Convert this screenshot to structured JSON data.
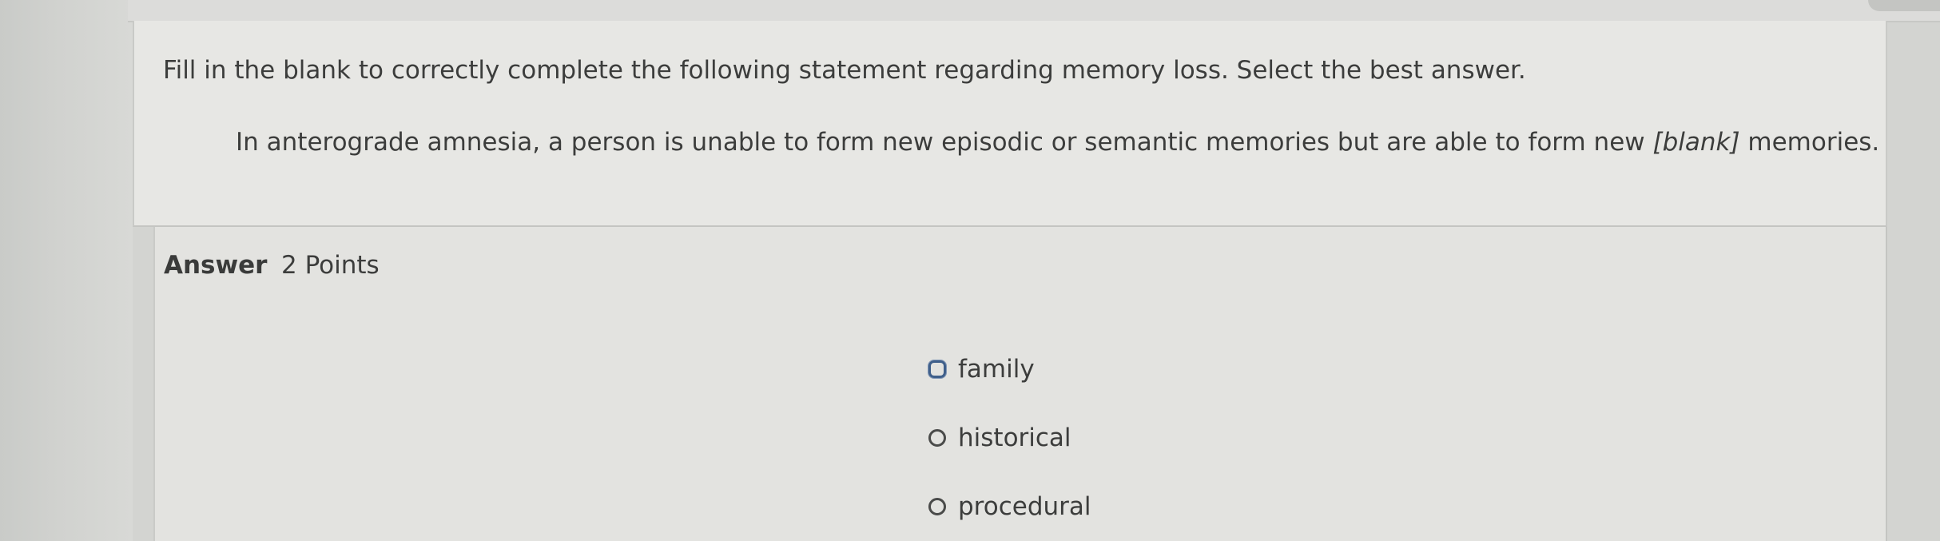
{
  "question": {
    "instruction": "Fill in the blank to correctly complete the following statement regarding memory loss. Select the best answer.",
    "statement_before": "In anterograde amnesia, a person is unable to form new episodic or semantic memories but are able to form new ",
    "statement_blank": "[blank]",
    "statement_after": " memories."
  },
  "answer": {
    "label": "Answer",
    "points": "2 Points",
    "options": [
      {
        "label": "family",
        "icon": "radio-icon",
        "focused": true
      },
      {
        "label": "historical",
        "icon": "radio-icon",
        "focused": false
      },
      {
        "label": "procedural",
        "icon": "radio-icon",
        "focused": false
      }
    ]
  },
  "colors": {
    "page_background": "#d3d4d1",
    "card_background": "#e7e7e4",
    "answer_background": "#e3e3e0",
    "text": "#3c3d3c",
    "focus_ring": "#3f5f8a"
  }
}
